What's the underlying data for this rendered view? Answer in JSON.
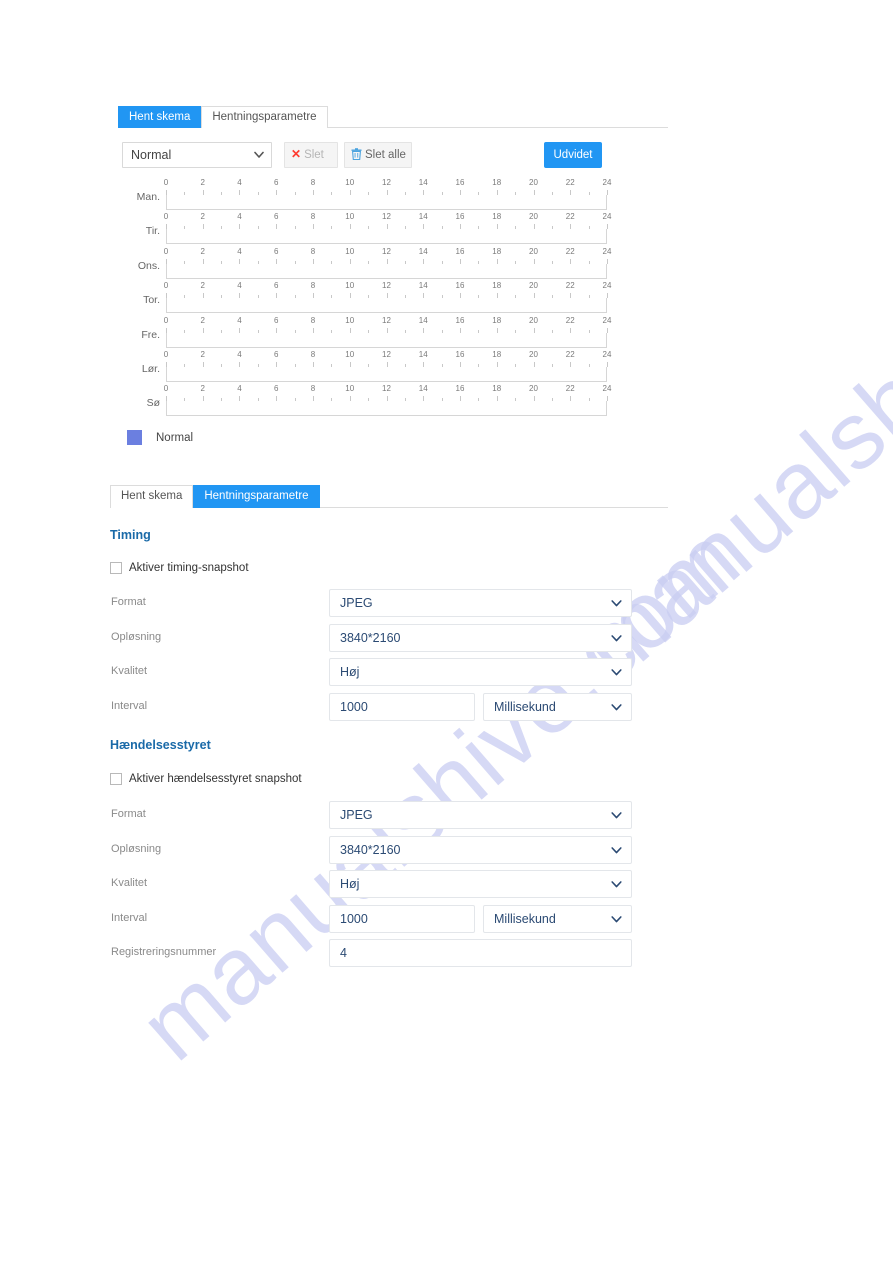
{
  "watermark": {
    "text": "manualshive.com"
  },
  "schedule_panel": {
    "tabs": [
      {
        "label": "Hent skema",
        "active": true
      },
      {
        "label": "Hentningsparametre",
        "active": false
      }
    ],
    "toolbar": {
      "period_select": {
        "value": "Normal",
        "icon": "chevron-down-icon"
      },
      "delete_button": {
        "label": "Slet",
        "icon": "close-x-icon"
      },
      "delete_all_button": {
        "label": "Slet alle",
        "icon": "trash-icon"
      },
      "advanced_button": {
        "label": "Udvidet"
      }
    },
    "axis_ticks": [
      "0",
      "2",
      "4",
      "6",
      "8",
      "10",
      "12",
      "14",
      "16",
      "18",
      "20",
      "22",
      "24"
    ],
    "days": [
      {
        "label": "Man."
      },
      {
        "label": "Tir."
      },
      {
        "label": "Ons."
      },
      {
        "label": "Tor."
      },
      {
        "label": "Fre."
      },
      {
        "label": "Lør."
      },
      {
        "label": "Sø"
      }
    ],
    "legend": [
      {
        "label": "Normal",
        "color": "#6b7fe0"
      }
    ]
  },
  "params_panel": {
    "tabs": [
      {
        "label": "Hent skema",
        "active": false
      },
      {
        "label": "Hentningsparametre",
        "active": true
      }
    ],
    "timing": {
      "title": "Timing",
      "enable_checkbox": {
        "label": "Aktiver timing-snapshot",
        "checked": false
      },
      "fields": [
        {
          "label": "Format",
          "value": "JPEG"
        },
        {
          "label": "Opløsning",
          "value": "3840*2160"
        },
        {
          "label": "Kvalitet",
          "value": "Høj"
        }
      ],
      "interval": {
        "label": "Interval",
        "value": "1000",
        "unit": "Millisekund"
      }
    },
    "event": {
      "title": "Hændelsesstyret",
      "enable_checkbox": {
        "label": "Aktiver hændelsesstyret snapshot",
        "checked": false
      },
      "fields": [
        {
          "label": "Format",
          "value": "JPEG"
        },
        {
          "label": "Opløsning",
          "value": "3840*2160"
        },
        {
          "label": "Kvalitet",
          "value": "Høj"
        }
      ],
      "interval": {
        "label": "Interval",
        "value": "1000",
        "unit": "Millisekund"
      },
      "number": {
        "label": "Registreringsnummer",
        "value": "4"
      }
    }
  },
  "colors": {
    "accent_blue": "#2196f3",
    "heading_blue": "#1a6aa8",
    "legend_normal": "#6b7fe0",
    "delete_red": "#ff3b30",
    "trash_blue": "#4aa3df"
  }
}
